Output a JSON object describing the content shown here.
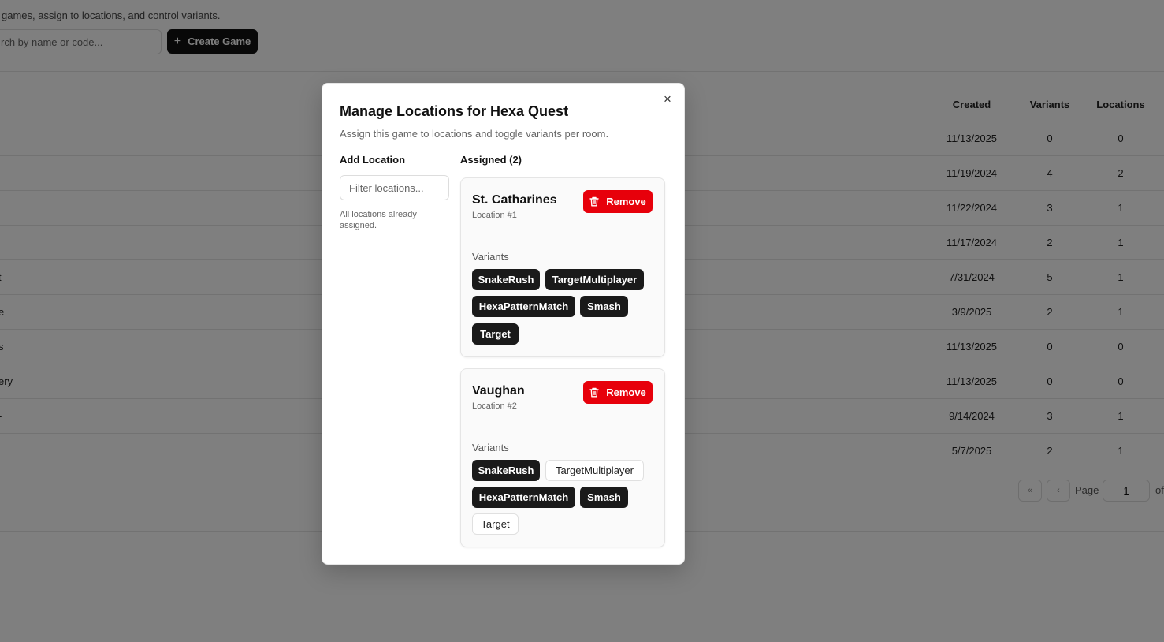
{
  "background": {
    "subtitle": "games, assign to locations, and control variants.",
    "search": {
      "placeholder": "rch by name or code..."
    },
    "create_button": {
      "label": "Create Game",
      "icon": "plus-icon"
    },
    "table": {
      "headers": {
        "created": "Created",
        "variants": "Variants",
        "locations": "Locations"
      },
      "rows": [
        {
          "name": "",
          "created": "11/13/2025",
          "variants": "0",
          "locations": "0"
        },
        {
          "name": "",
          "created": "11/19/2024",
          "variants": "4",
          "locations": "2"
        },
        {
          "name": "",
          "created": "11/22/2024",
          "variants": "3",
          "locations": "1"
        },
        {
          "name": "",
          "created": "11/17/2024",
          "variants": "2",
          "locations": "1"
        },
        {
          "name": "t",
          "created": "7/31/2024",
          "variants": "5",
          "locations": "1"
        },
        {
          "name": "e",
          "created": "3/9/2025",
          "variants": "2",
          "locations": "1"
        },
        {
          "name": "s",
          "created": "11/13/2025",
          "variants": "0",
          "locations": "0"
        },
        {
          "name": "ery",
          "created": "11/13/2025",
          "variants": "0",
          "locations": "0"
        },
        {
          "name": "-",
          "created": "9/14/2024",
          "variants": "3",
          "locations": "1"
        },
        {
          "name": "",
          "created": "5/7/2025",
          "variants": "2",
          "locations": "1"
        }
      ]
    },
    "pagination": {
      "first": "«",
      "prev": "‹",
      "page_label": "Page",
      "page_value": "1",
      "of_label": "of"
    }
  },
  "modal": {
    "title": "Manage Locations for Hexa Quest",
    "description": "Assign this game to locations and toggle variants per room.",
    "close_icon": "close-icon",
    "close_glyph": "×",
    "add_location": {
      "heading": "Add Location",
      "filter_placeholder": "Filter locations...",
      "empty_text": "All locations already assigned."
    },
    "assigned": {
      "heading": "Assigned (2)",
      "remove_label": "Remove",
      "variants_label": "Variants",
      "locations": [
        {
          "name": "St. Catharines",
          "number": "Location #1",
          "variants": [
            {
              "label": "SnakeRush",
              "enabled": true
            },
            {
              "label": "TargetMultiplayer",
              "enabled": true
            },
            {
              "label": "HexaPatternMatch",
              "enabled": true
            },
            {
              "label": "Smash",
              "enabled": true
            },
            {
              "label": "Target",
              "enabled": true
            }
          ]
        },
        {
          "name": "Vaughan",
          "number": "Location #2",
          "variants": [
            {
              "label": "SnakeRush",
              "enabled": true
            },
            {
              "label": "TargetMultiplayer",
              "enabled": false
            },
            {
              "label": "HexaPatternMatch",
              "enabled": true
            },
            {
              "label": "Smash",
              "enabled": true
            },
            {
              "label": "Target",
              "enabled": false
            }
          ]
        }
      ]
    }
  },
  "colors": {
    "remove": "#e7000b",
    "chip_on": "#1a1a1a",
    "overlay": "rgba(0,0,0,0.5)"
  }
}
